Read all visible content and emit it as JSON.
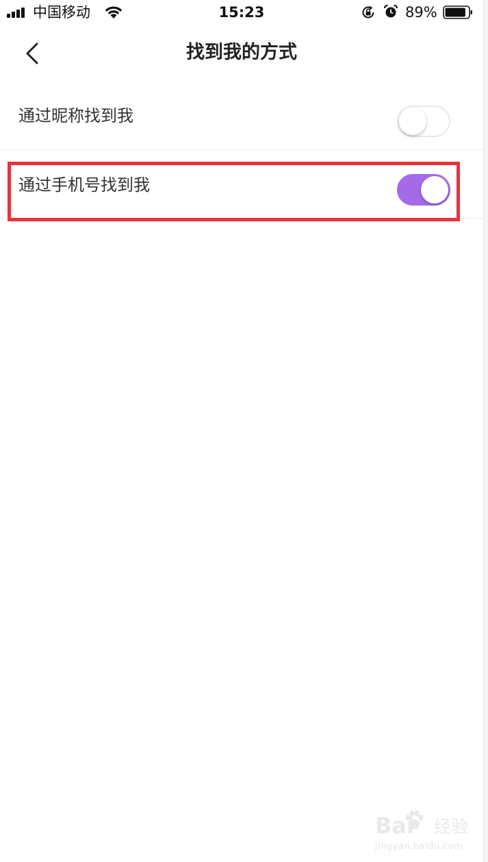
{
  "status_bar": {
    "carrier": "中国移动",
    "time": "15:23",
    "battery_percent": "89%",
    "battery_level": 0.89,
    "icons": [
      "signal-icon",
      "wifi-icon",
      "rotation-lock-icon",
      "alarm-icon",
      "battery-icon"
    ]
  },
  "nav": {
    "title": "找到我的方式",
    "back_icon": "chevron-left-icon"
  },
  "settings": [
    {
      "label": "通过昵称找到我",
      "enabled": false
    },
    {
      "label": "通过手机号找到我",
      "enabled": true
    }
  ],
  "colors": {
    "toggle_on": "#a56ae8",
    "toggle_off_border": "#e8e8e8",
    "highlight": "#e8313a"
  },
  "watermark": {
    "logo": "Bai",
    "brand": "经验",
    "url": "jingyan.baidu.com"
  }
}
